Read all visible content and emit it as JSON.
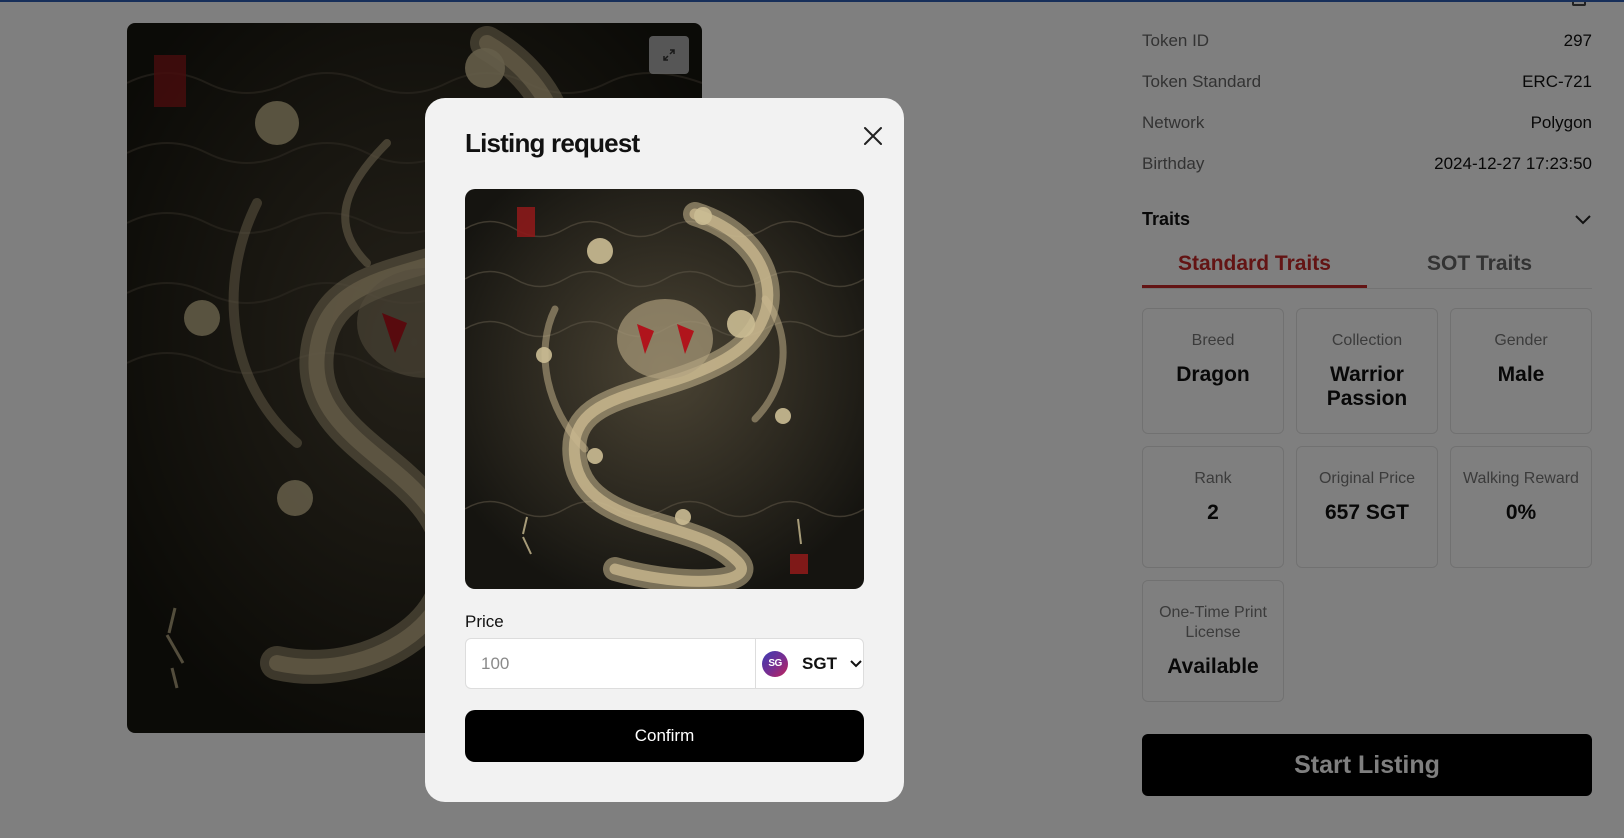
{
  "details": {
    "rows": [
      {
        "key": "Token ID",
        "value": "297"
      },
      {
        "key": "Token Standard",
        "value": "ERC-721"
      },
      {
        "key": "Network",
        "value": "Polygon"
      },
      {
        "key": "Birthday",
        "value": "2024-12-27 17:23:50"
      }
    ]
  },
  "traits": {
    "title": "Traits",
    "tabs": [
      {
        "label": "Standard Traits",
        "active": true
      },
      {
        "label": "SOT Traits",
        "active": false
      }
    ],
    "cards": [
      {
        "label": "Breed",
        "value": "Dragon"
      },
      {
        "label": "Collection",
        "value": "Warrior Passion"
      },
      {
        "label": "Gender",
        "value": "Male"
      },
      {
        "label": "Rank",
        "value": "2"
      },
      {
        "label": "Original Price",
        "value": "657 SGT"
      },
      {
        "label": "Walking Reward",
        "value": "0%"
      },
      {
        "label": "One-Time Print License",
        "value": "Available"
      }
    ]
  },
  "start_listing": {
    "label": "Start Listing"
  },
  "modal": {
    "title": "Listing request",
    "price_label": "Price",
    "price_placeholder": "100",
    "currency": {
      "code": "SGT",
      "icon_text": "SG",
      "icon": "sgt-coin-icon"
    },
    "confirm_label": "Confirm"
  },
  "colors": {
    "accent": "#c62828",
    "button": "#000000",
    "overlay": "rgba(0,0,0,0.5)",
    "top_line": "#2f5fb5"
  }
}
